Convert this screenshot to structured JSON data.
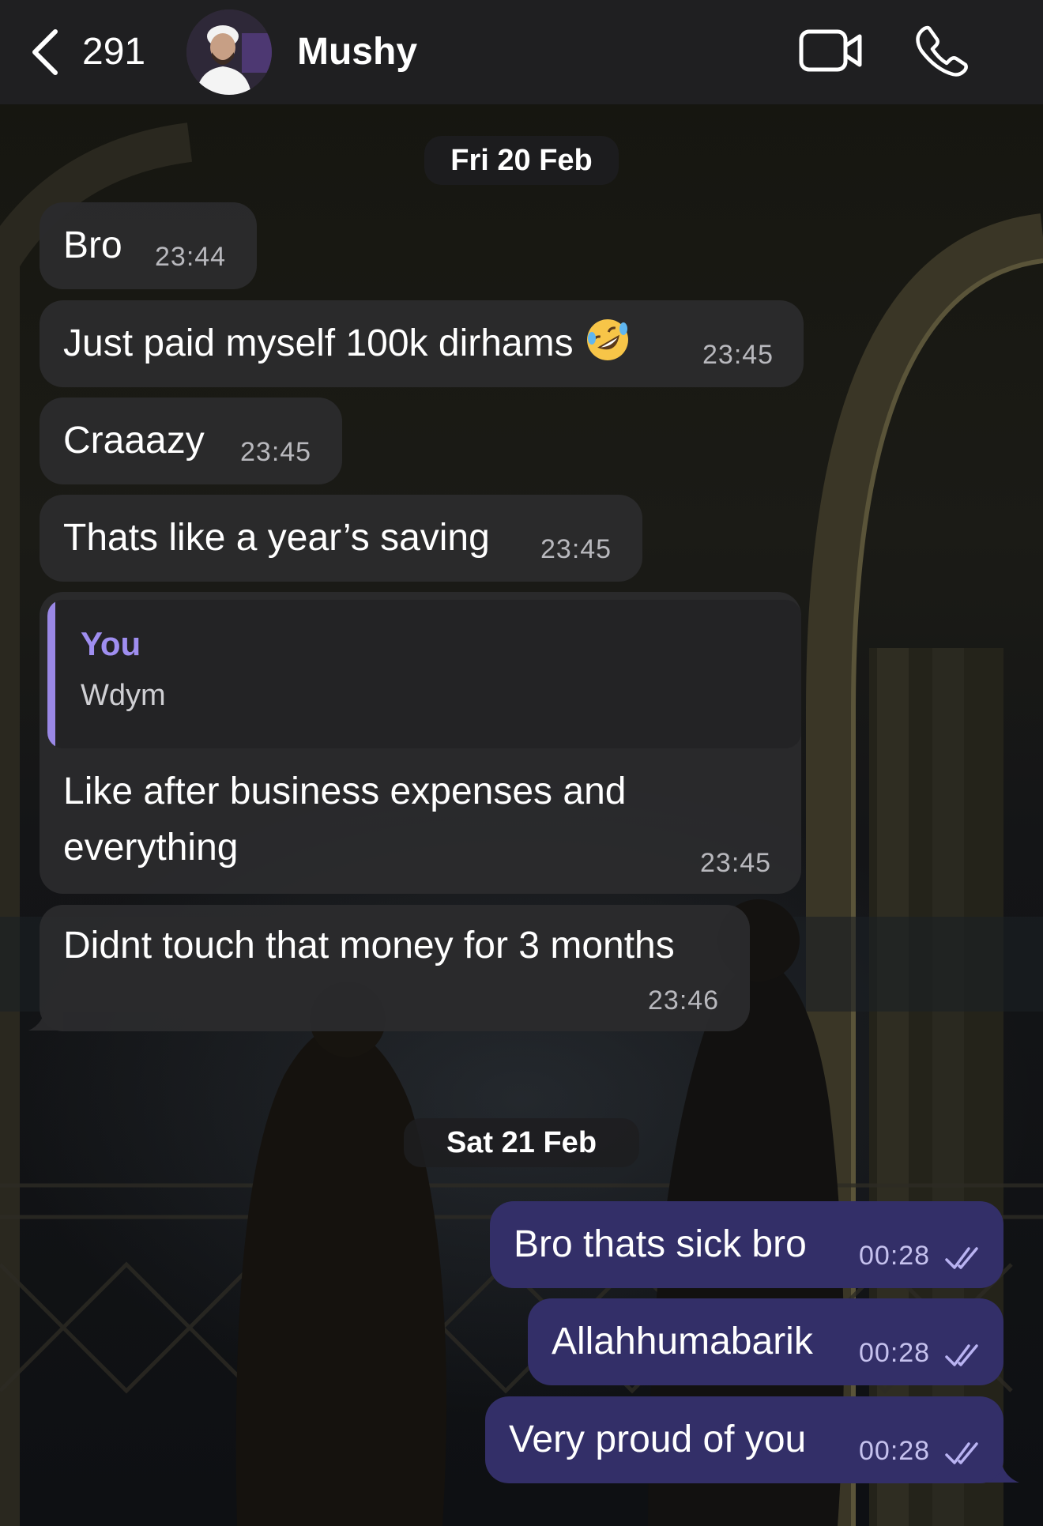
{
  "header": {
    "back_count": "291",
    "contact_name": "Mushy",
    "icons": [
      "chevron-left-icon",
      "video-call-icon",
      "phone-icon"
    ]
  },
  "dates": [
    "Fri 20 Feb",
    "Sat 21 Feb"
  ],
  "messages": [
    {
      "text": "Bro",
      "time": "23:44",
      "direction": "incoming"
    },
    {
      "text": "Just paid myself 100k dirhams",
      "emoji": "rolling-on-floor-laughing-emoji",
      "time": "23:45",
      "direction": "incoming"
    },
    {
      "text": "Craaazy",
      "time": "23:45",
      "direction": "incoming"
    },
    {
      "text": "Thats like a year’s saving",
      "time": "23:45",
      "direction": "incoming"
    },
    {
      "reply_author": "You",
      "reply_text": "Wdym",
      "line1": "Like after business expenses and",
      "line2": "everything",
      "time": "23:45",
      "direction": "incoming"
    },
    {
      "text": "Didnt touch that money for 3 months",
      "time": "23:46",
      "direction": "incoming"
    },
    {
      "text": "Bro thats sick bro",
      "time": "00:28",
      "direction": "outgoing",
      "status": "read"
    },
    {
      "text": "Allahhumabarik",
      "time": "00:28",
      "direction": "outgoing",
      "status": "read"
    },
    {
      "text": "Very proud of you",
      "time": "00:28",
      "direction": "outgoing",
      "status": "read"
    }
  ],
  "colors": {
    "header_bg": "#1f1f21",
    "incoming_bubble": "#2b2b2d",
    "outgoing_bubble": "#332f68",
    "accent": "#9f8ef0"
  }
}
